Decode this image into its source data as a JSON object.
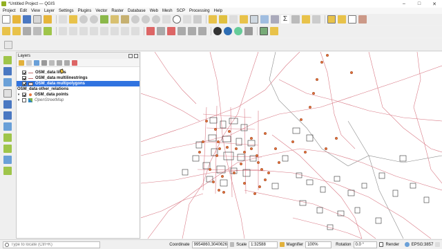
{
  "window": {
    "title": "*Untitled Project — QGIS"
  },
  "menu": [
    "Project",
    "Edit",
    "View",
    "Layer",
    "Settings",
    "Plugins",
    "Vector",
    "Raster",
    "Database",
    "Web",
    "Mesh",
    "SCP",
    "Processing",
    "Help"
  ],
  "layers_panel": {
    "title": "Layers",
    "layers": [
      {
        "label": "OSM_data lines",
        "checked": true,
        "symbol": "line-symbol-icon"
      },
      {
        "label": "OSM_data multilinestrings",
        "checked": true,
        "symbol": "line-symbol-icon"
      },
      {
        "label": "OSM_data multipolygons",
        "checked": true,
        "symbol": "polygon-symbol-icon",
        "selected": true
      },
      {
        "label": "OSM_data other_relations",
        "checked": false,
        "symbol": "none"
      },
      {
        "label": "OSM_data points",
        "checked": true,
        "symbol": "point-symbol-icon"
      },
      {
        "label": "OpenStreetMap",
        "checked": false,
        "symbol": "osm-tile-icon"
      }
    ]
  },
  "statusbar": {
    "locator_placeholder": "Type to locate (Ctrl+K)",
    "coordinate_label": "Coordinate",
    "coordinate_value": "9954860,3040626",
    "scale_label": "Scale",
    "scale_value": "1:32588",
    "magnifier_label": "Magnifier",
    "magnifier_value": "100%",
    "rotation_label": "Rotation",
    "rotation_value": "0.0 °",
    "render_label": "Render",
    "crs_label": "EPSG:3857"
  },
  "colors": {
    "road": "#d97a86",
    "building": "#333333",
    "point": "#e2703a",
    "river": "#8a8a8a",
    "selection": "#3073e0"
  }
}
